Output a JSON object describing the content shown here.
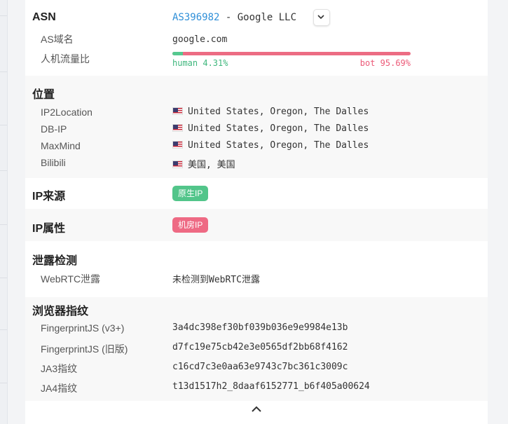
{
  "asn": {
    "title": "ASN",
    "link": "AS396982",
    "separator": " - ",
    "org": "Google LLC",
    "domain_label": "AS域名",
    "domain_value": "google.com",
    "traffic_label": "人机流量比",
    "human_label": "human 4.31%",
    "bot_label": "bot 95.69%",
    "human_percent": 4.31,
    "bot_percent": 95.69
  },
  "location": {
    "title": "位置",
    "rows": [
      {
        "label": "IP2Location",
        "value": "United States, Oregon, The Dalles"
      },
      {
        "label": "DB-IP",
        "value": "United States, Oregon, The Dalles"
      },
      {
        "label": "MaxMind",
        "value": "United States, Oregon, The Dalles"
      },
      {
        "label": "Bilibili",
        "value": "美国, 美国"
      }
    ]
  },
  "ip_source": {
    "title": "IP来源",
    "badge": "原生IP"
  },
  "ip_type": {
    "title": "IP属性",
    "badge": "机房IP"
  },
  "leak": {
    "title": "泄露检测",
    "rows": [
      {
        "label": "WebRTC泄露",
        "value": "未检测到WebRTC泄露"
      }
    ]
  },
  "fingerprint": {
    "title": "浏览器指纹",
    "rows": [
      {
        "label": "FingerprintJS (v3+)",
        "value": "3a4dc398ef30bf039b036e9e9984e13b"
      },
      {
        "label": "FingerprintJS (旧版)",
        "value": "d7fc19e75cb42e3e0565df2bb68f4162"
      },
      {
        "label": "JA3指纹",
        "value": "c16cd7c3e0aa63e9743c7bc361c3009c"
      },
      {
        "label": "JA4指纹",
        "value": "t13d1517h2_8daaf6152771_b6f405a00624"
      }
    ]
  },
  "colors": {
    "link": "#2f8fd8",
    "human": "#55c98f",
    "bot": "#ec6c83",
    "badge_green": "#52c58a",
    "badge_pink": "#ee6a84"
  },
  "icons": {
    "dropdown": "chevron-down-icon",
    "collapse": "chevron-up-icon",
    "flag": "us-flag-icon"
  }
}
